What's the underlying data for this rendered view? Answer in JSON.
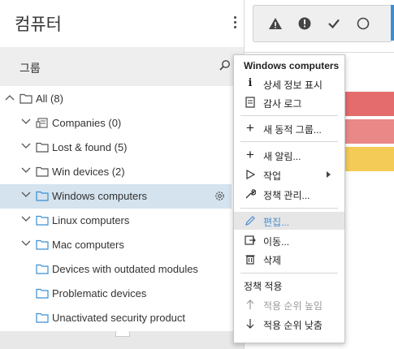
{
  "panel": {
    "title": "컴퓨터",
    "group_label": "그룹"
  },
  "tree": [
    {
      "label": "All (8)",
      "expanded": true,
      "icon": "folder-icon"
    },
    {
      "label": "Companies (0)",
      "icon": "companies-icon"
    },
    {
      "label": "Lost & found (5)",
      "icon": "folder-icon"
    },
    {
      "label": "Win devices (2)",
      "icon": "folder-icon"
    },
    {
      "label": "Windows computers",
      "icon": "folder-icon",
      "selected": true
    },
    {
      "label": "Linux computers",
      "icon": "folder-icon"
    },
    {
      "label": "Mac computers",
      "icon": "folder-icon"
    },
    {
      "label": "Devices with outdated modules",
      "icon": "folder-icon"
    },
    {
      "label": "Problematic devices",
      "icon": "folder-icon"
    },
    {
      "label": "Unactivated security product",
      "icon": "folder-icon"
    }
  ],
  "menu": {
    "header": "Windows computers",
    "items": [
      {
        "label": "상세 정보 표시",
        "icon": "info-icon"
      },
      {
        "label": "감사 로그",
        "icon": "audit-log-icon"
      },
      {
        "label": "새 동적 그룹...",
        "icon": "plus-icon"
      },
      {
        "label": "새 알림...",
        "icon": "plus-icon"
      },
      {
        "label": "작업",
        "icon": "play-icon"
      },
      {
        "label": "정책 관리...",
        "icon": "wrench-icon"
      },
      {
        "label": "편집...",
        "icon": "pencil-icon"
      },
      {
        "label": "이동...",
        "icon": "move-icon"
      },
      {
        "label": "삭제",
        "icon": "trash-icon"
      }
    ],
    "policy_header": "정책 적용",
    "policy_items": [
      {
        "label": "적용 순위 높임",
        "icon": "arrow-up-icon",
        "disabled": true
      },
      {
        "label": "적용 순위 낮춤",
        "icon": "arrow-down-icon",
        "disabled": false
      }
    ]
  },
  "colors": {
    "selected_row": "#d4e3ee",
    "folder": "#3a8fd4",
    "warning_red": "#e05252",
    "warning_yellow": "#f2c23a"
  }
}
